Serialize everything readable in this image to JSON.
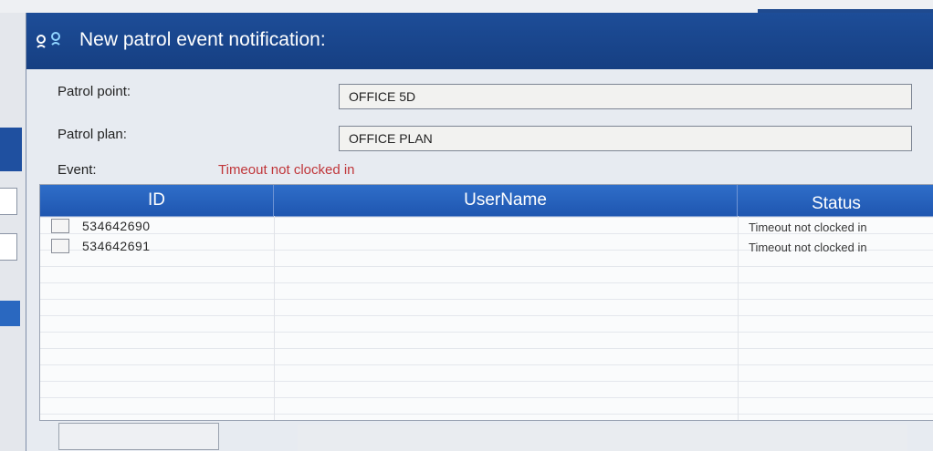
{
  "dialog": {
    "title": "New patrol event notification:",
    "title_icon": "patrol-points-icon"
  },
  "fields": {
    "patrol_point_label": "Patrol point:",
    "patrol_point_value": "OFFICE 5D",
    "patrol_plan_label": "Patrol plan:",
    "patrol_plan_value": "OFFICE PLAN"
  },
  "event": {
    "label": "Event:",
    "value": "Timeout not clocked in",
    "color": "#c0363a"
  },
  "grid": {
    "columns": [
      "ID",
      "UserName",
      "Status"
    ],
    "rows": [
      {
        "id": "534642690",
        "username": "",
        "status": "Timeout not clocked in"
      },
      {
        "id": "534642691",
        "username": "",
        "status": "Timeout not clocked in"
      }
    ],
    "header_color": "#1f56b0"
  }
}
